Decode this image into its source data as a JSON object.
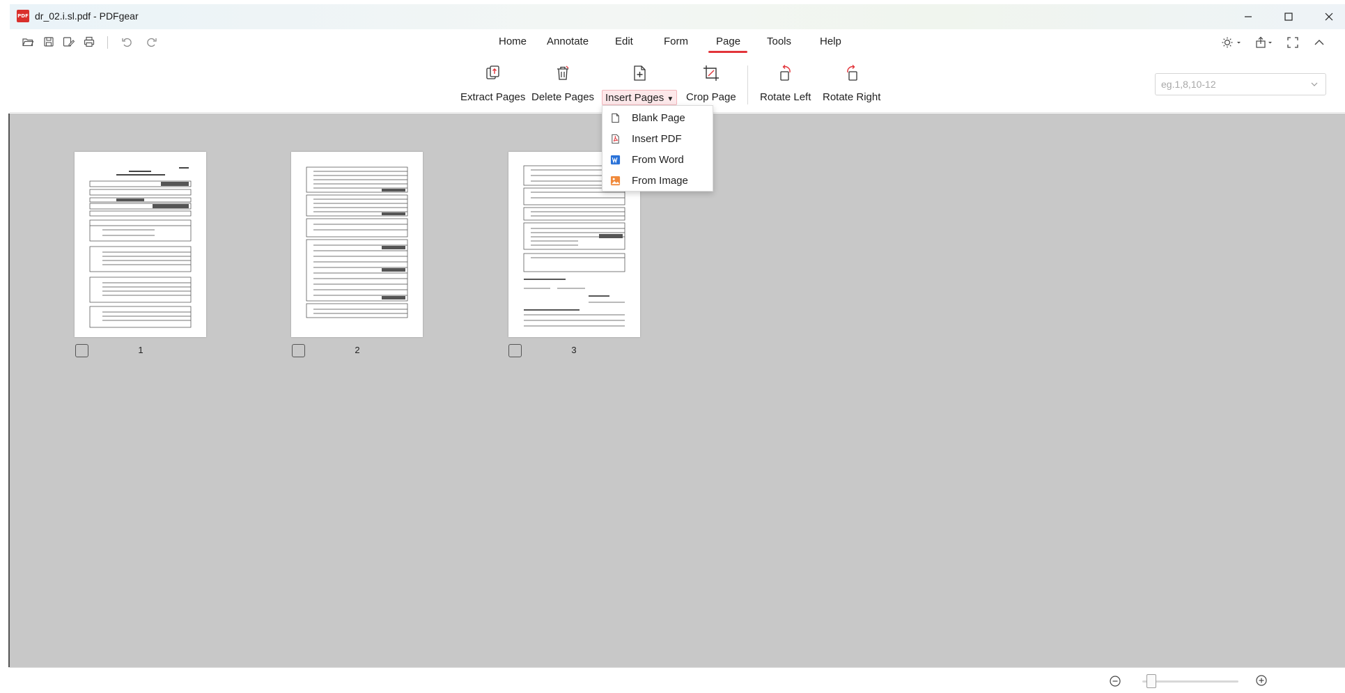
{
  "window": {
    "title": "dr_02.i.sl.pdf - PDFgear",
    "logo_text": "PDF",
    "controls": [
      "minimize",
      "maximize",
      "close"
    ]
  },
  "quick_access": {
    "icons": [
      "open-folder-icon",
      "save-icon",
      "save-as-icon",
      "print-icon",
      "undo-icon",
      "redo-icon"
    ]
  },
  "menu": {
    "items": [
      {
        "label": "Home"
      },
      {
        "label": "Annotate"
      },
      {
        "label": "Edit"
      },
      {
        "label": "Form"
      },
      {
        "label": "Page",
        "active": true
      },
      {
        "label": "Tools"
      },
      {
        "label": "Help"
      }
    ],
    "accent_color": "#e2343a",
    "right_icons": [
      "theme-sun-icon",
      "share-icon",
      "fullscreen-icon",
      "collapse-ribbon-icon"
    ]
  },
  "ribbon": {
    "tools": [
      {
        "label": "Extract Pages",
        "icon": "extract-pages-icon"
      },
      {
        "label": "Delete Pages",
        "icon": "delete-pages-icon"
      },
      {
        "label": "Insert Pages",
        "icon": "insert-pages-icon",
        "active": true,
        "has_dropdown": true
      },
      {
        "label": "Crop Page",
        "icon": "crop-page-icon"
      },
      {
        "label": "Rotate Left",
        "icon": "rotate-left-icon"
      },
      {
        "label": "Rotate Right",
        "icon": "rotate-right-icon"
      }
    ],
    "page_range": {
      "value": "",
      "placeholder": "eg.1,8,10-12"
    }
  },
  "insert_dropdown": {
    "items": [
      {
        "label": "Blank Page",
        "icon": "blank-page-icon"
      },
      {
        "label": "Insert PDF",
        "icon": "pdf-file-icon"
      },
      {
        "label": "From Word",
        "icon": "word-icon"
      },
      {
        "label": "From Image",
        "icon": "image-icon"
      }
    ]
  },
  "pages": [
    {
      "number": "1",
      "checked": false
    },
    {
      "number": "2",
      "checked": false
    },
    {
      "number": "3",
      "checked": false
    }
  ],
  "status": {
    "zoom_level": 0.05,
    "zoom_out_icon": "zoom-out-icon",
    "zoom_in_icon": "zoom-in-icon"
  }
}
